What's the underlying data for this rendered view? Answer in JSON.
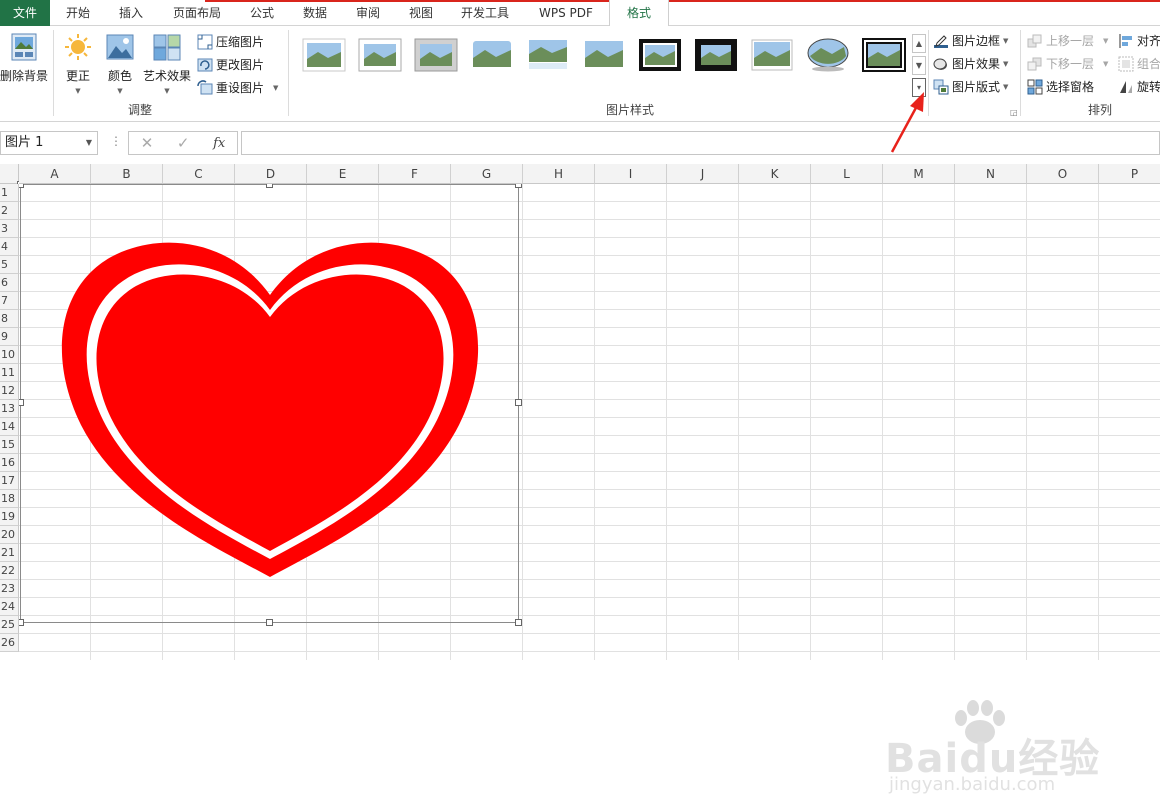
{
  "tabs": {
    "file": "文件",
    "home": "开始",
    "insert": "插入",
    "layout": "页面布局",
    "formulas": "公式",
    "data": "数据",
    "review": "审阅",
    "view": "视图",
    "developer": "开发工具",
    "wps_pdf": "WPS PDF",
    "format": "格式"
  },
  "ribbon": {
    "adjust": {
      "remove_bg": "删除背景",
      "corrections": "更正",
      "color": "颜色",
      "artistic": "艺术效果",
      "compress": "压缩图片",
      "change": "更改图片",
      "reset": "重设图片",
      "group_label": "调整"
    },
    "styles": {
      "group_label": "图片样式"
    },
    "picture_opts": {
      "border": "图片边框",
      "effects": "图片效果",
      "layout": "图片版式"
    },
    "arrange": {
      "bring_forward": "上移一层",
      "send_backward": "下移一层",
      "selection_pane": "选择窗格",
      "align": "对齐",
      "group": "组合",
      "rotate": "旋转",
      "group_label": "排列"
    }
  },
  "formula_bar": {
    "name_box": "图片 1",
    "cancel": "✕",
    "enter": "✓",
    "fx": "fx",
    "value": ""
  },
  "columns": [
    "A",
    "B",
    "C",
    "D",
    "E",
    "F",
    "G",
    "H",
    "I",
    "J",
    "K",
    "L",
    "M",
    "N",
    "O",
    "P"
  ],
  "rows": [
    "1",
    "2",
    "3",
    "4",
    "5",
    "6",
    "7",
    "8",
    "9",
    "10",
    "11",
    "12",
    "13",
    "14",
    "15",
    "16",
    "17",
    "18",
    "19",
    "20",
    "21",
    "22",
    "23",
    "24",
    "25",
    "26"
  ],
  "watermark": {
    "brand": "Baidu",
    "brand_cn": "经验",
    "url": "jingyan.baidu.com"
  },
  "colors": {
    "accent": "#217346",
    "heart": "#ff0000",
    "arrow": "#e8221b",
    "tab_line": "#d9251c"
  }
}
